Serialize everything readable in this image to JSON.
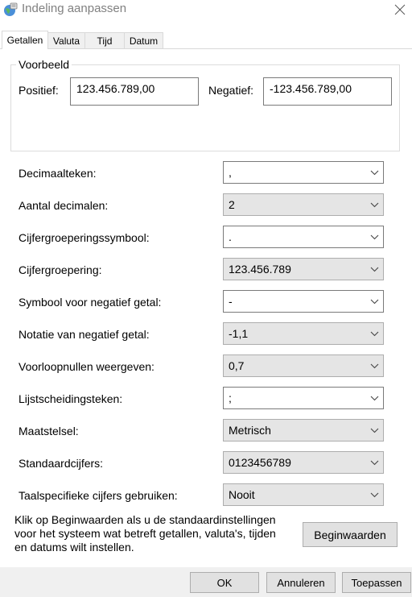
{
  "window": {
    "title": "Indeling aanpassen",
    "icon": "globe-icon"
  },
  "tabs": [
    {
      "label": "Getallen",
      "active": true
    },
    {
      "label": "Valuta",
      "active": false
    },
    {
      "label": "Tijd",
      "active": false
    },
    {
      "label": "Datum",
      "active": false
    }
  ],
  "preview": {
    "legend": "Voorbeeld",
    "positive_label": "Positief:",
    "positive_value": "123.456.789,00",
    "negative_label": "Negatief:",
    "negative_value": "-123.456.789,00"
  },
  "settings": [
    {
      "label": "Decimaalteken:",
      "value": ",",
      "style": "editable"
    },
    {
      "label": "Aantal decimalen:",
      "value": "2",
      "style": "dropdown"
    },
    {
      "label": "Cijfergroeperingssymbool:",
      "value": ".",
      "style": "editable"
    },
    {
      "label": "Cijfergroepering:",
      "value": "123.456.789",
      "style": "dropdown"
    },
    {
      "label": "Symbool voor negatief getal:",
      "value": "-",
      "style": "editable"
    },
    {
      "label": "Notatie van negatief getal:",
      "value": "-1,1",
      "style": "dropdown"
    },
    {
      "label": "Voorloopnullen weergeven:",
      "value": "0,7",
      "style": "dropdown"
    },
    {
      "label": "Lijstscheidingsteken:",
      "value": ";",
      "style": "editable"
    },
    {
      "label": "Maatstelsel:",
      "value": "Metrisch",
      "style": "dropdown"
    },
    {
      "label": "Standaardcijfers:",
      "value": "0123456789",
      "style": "dropdown"
    },
    {
      "label": "Taalspecifieke cijfers gebruiken:",
      "value": "Nooit",
      "style": "dropdown"
    }
  ],
  "info": {
    "lines": [
      "Klik op Beginwaarden als u de standaardinstellingen",
      "voor het systeem wat betreft getallen, valuta's, tijden",
      "en datums wilt instellen."
    ],
    "reset_label": "Beginwaarden"
  },
  "footer": {
    "ok_label": "OK",
    "cancel_label": "Annuleren",
    "apply_label": "Toepassen"
  },
  "colors": {
    "combo_dropdown_bg": "#e5e5e5",
    "button_bg": "#e1e1e1",
    "footer_bg": "#f0f0f0"
  }
}
